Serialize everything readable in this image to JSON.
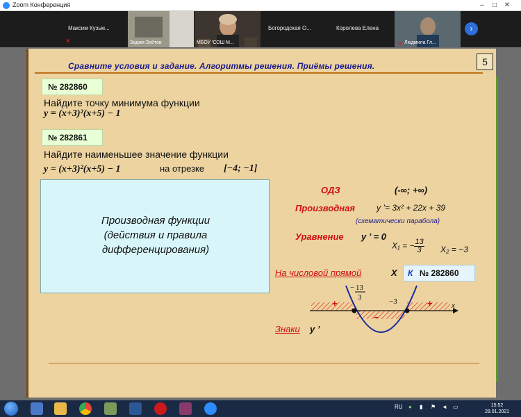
{
  "window": {
    "title": "Zoom Конференция",
    "minimize": "–",
    "maximize": "□",
    "close": "✕"
  },
  "participants": [
    {
      "name": "Максим  Кузьм...",
      "muted": true
    },
    {
      "name": "Задим Зойтов",
      "muted": false
    },
    {
      "name": "МБОУ 'СОШ М...",
      "muted": true
    },
    {
      "name": "Богородская  О...",
      "muted": false
    },
    {
      "name": "Королева Елена",
      "muted": false
    },
    {
      "name": "Людмила Гл...",
      "muted": true
    }
  ],
  "slide": {
    "heading": "Сравните условия и задание. Алгоритмы решения. Приёмы решения.",
    "page_number": "5",
    "task1": {
      "number": "№ 282860",
      "text": "Найдите точку минимума функции",
      "formula": "y = (x+3)²(x+5) − 1"
    },
    "task2": {
      "number": "№ 282861",
      "text": "Найдите наименьшее значение функции",
      "formula": "y = (x+3)²(x+5) − 1",
      "interval_label": "на отрезке",
      "interval": "[−4; −1]"
    },
    "derivative_box": {
      "line1": "Производная функции",
      "line2": "(действия и правила",
      "line3": "дифференцирования)"
    },
    "odz": {
      "label": "ОДЗ",
      "value": "(-∞; +∞)"
    },
    "derivative": {
      "label": "Производная",
      "value": "y ’= 3x² + 22x + 39",
      "note": "(схематически парабола)"
    },
    "equation": {
      "label": "Уравнение",
      "value": "y ’ = 0",
      "x1": "X₁ = −",
      "x1_num": "13",
      "x1_den": "3",
      "x2": "X₂ = −3"
    },
    "number_line": {
      "label": "На числовой прямой",
      "var": "X",
      "k_label": "К",
      "ref": "№ 282860",
      "axis": "x",
      "point1_num": "13",
      "point1_den": "3",
      "point1_sign": "−",
      "point2": "−3",
      "signs": [
        "+",
        "−",
        "+"
      ]
    },
    "signs": {
      "label": "Знаки",
      "var": "y ’"
    }
  },
  "taskbar": {
    "lang": "RU",
    "time": "15:52",
    "date": "28.01.2021"
  },
  "colors": {
    "slide_bg": "#ecd3a0",
    "heading": "#1a1a8a",
    "accent_red": "#d01010",
    "box_blue": "#d8f6fa",
    "tag_green": "#e9ffd6"
  }
}
